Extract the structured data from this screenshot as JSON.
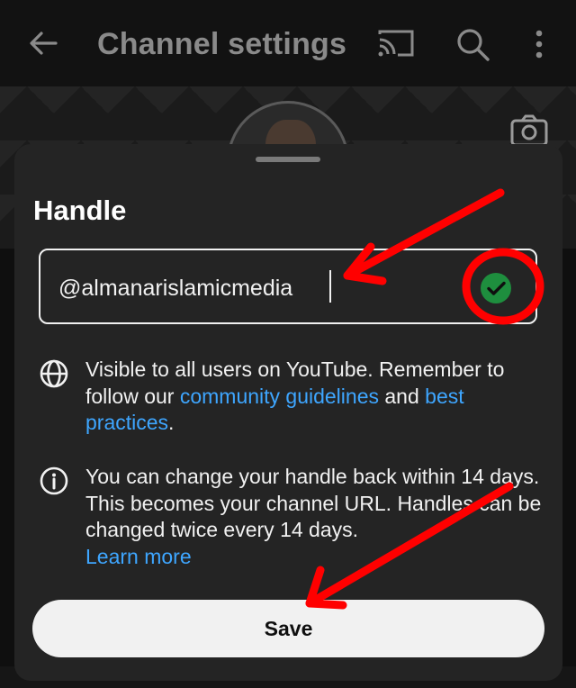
{
  "appbar": {
    "title": "Channel settings",
    "icons": [
      "back-arrow-icon",
      "cast-icon",
      "search-icon",
      "more-vert-icon"
    ]
  },
  "banner": {
    "icons": [
      "camera-icon"
    ]
  },
  "sheet": {
    "title": "Handle",
    "handle_value": "@almanarislamicmedia",
    "status_icon": "check-circle-icon",
    "status_color": "#1e8e3e",
    "visibility": {
      "icon": "globe-icon",
      "text_before": "Visible to all users on YouTube. Remember to follow our ",
      "link1": "community guidelines",
      "text_mid": " and ",
      "link2": "best practices",
      "text_after": "."
    },
    "change_info": {
      "icon": "info-icon",
      "text": "You can change your handle back within 14 days. This becomes your channel URL. Handles can be changed twice every 14 days.",
      "link": "Learn more"
    },
    "save_label": "Save"
  },
  "colors": {
    "background": "#0f0f0f",
    "sheet": "#242424",
    "link": "#3ea6ff",
    "annotation": "#ff0000"
  }
}
